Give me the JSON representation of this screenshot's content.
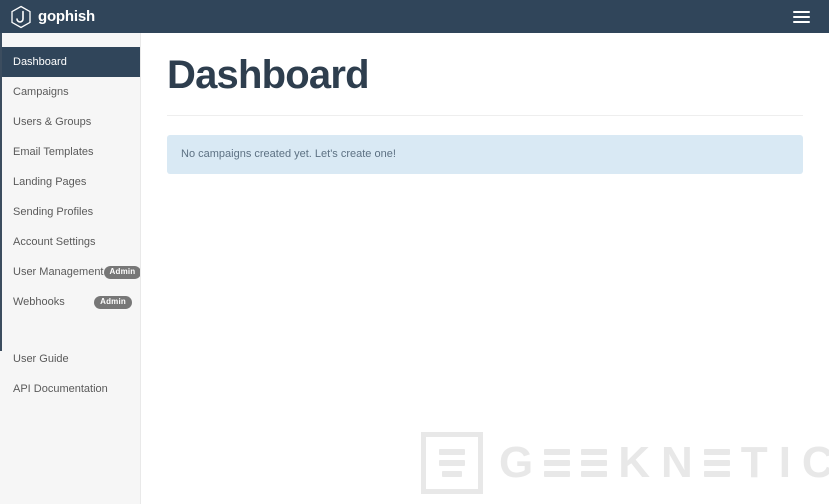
{
  "navbar": {
    "brand_text": "gophish",
    "brand_logo_icon": "gophish-hexagon-hook-logo",
    "menu_icon": "hamburger-menu-icon"
  },
  "sidebar": {
    "items": [
      {
        "label": "Dashboard",
        "active": true,
        "badge": null
      },
      {
        "label": "Campaigns",
        "active": false,
        "badge": null
      },
      {
        "label": "Users & Groups",
        "active": false,
        "badge": null
      },
      {
        "label": "Email Templates",
        "active": false,
        "badge": null
      },
      {
        "label": "Landing Pages",
        "active": false,
        "badge": null
      },
      {
        "label": "Sending Profiles",
        "active": false,
        "badge": null
      },
      {
        "label": "Account Settings",
        "active": false,
        "badge": null
      },
      {
        "label": "User Management",
        "active": false,
        "badge": "Admin"
      },
      {
        "label": "Webhooks",
        "active": false,
        "badge": "Admin"
      }
    ],
    "footer_items": [
      {
        "label": "User Guide"
      },
      {
        "label": "API Documentation"
      }
    ]
  },
  "main": {
    "title": "Dashboard",
    "alert_message": "No campaigns created yet. Let's create one!"
  },
  "watermark": {
    "text": "GEEKNETIC",
    "letters": [
      "G",
      "E",
      "E",
      "K",
      "N",
      "E",
      "T",
      "I",
      "C"
    ],
    "logo_icon": "geeknetic-box-logo"
  },
  "colors": {
    "navbar_bg": "#30455a",
    "sidebar_bg": "#f6f6f6",
    "active_item_bg": "#30445a",
    "title_color": "#2e3e4e",
    "alert_bg": "#d9e9f4",
    "alert_text": "#5d7183",
    "badge_bg": "#777777",
    "watermark_color": "#e8e8e8"
  }
}
